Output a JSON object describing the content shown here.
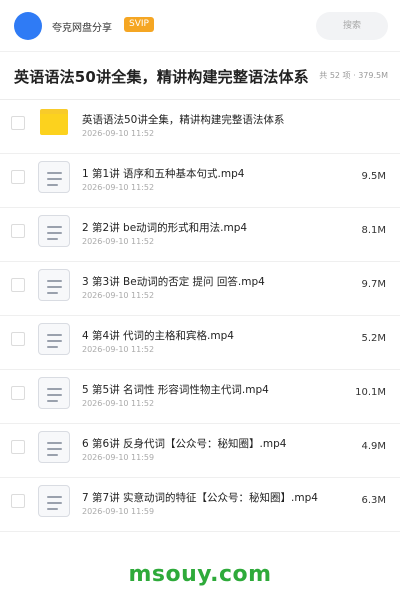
{
  "header": {
    "brand": "夸克网盘分享",
    "badge": "SVIP",
    "search_placeholder": "搜索"
  },
  "title_bar": {
    "title": "英语语法50讲全集，精讲构建完整语法体系",
    "meta": "共 52 项 · 379.5M"
  },
  "files": [
    {
      "type": "folder",
      "name": "英语语法50讲全集，精讲构建完整语法体系",
      "date": "2026-09-10 11:52",
      "size": ""
    },
    {
      "type": "file",
      "name": "1 第1讲 语序和五种基本句式.mp4",
      "date": "2026-09-10 11:52",
      "size": "9.5M"
    },
    {
      "type": "file",
      "name": "2 第2讲 be动词的形式和用法.mp4",
      "date": "2026-09-10 11:52",
      "size": "8.1M"
    },
    {
      "type": "file",
      "name": "3 第3讲 Be动词的否定 提问 回答.mp4",
      "date": "2026-09-10 11:52",
      "size": "9.7M"
    },
    {
      "type": "file",
      "name": "4 第4讲 代词的主格和宾格.mp4",
      "date": "2026-09-10 11:52",
      "size": "5.2M"
    },
    {
      "type": "file",
      "name": "5 第5讲 名词性 形容词性物主代词.mp4",
      "date": "2026-09-10 11:52",
      "size": "10.1M"
    },
    {
      "type": "file",
      "name": "6 第6讲 反身代词【公众号：秘知圈】.mp4",
      "date": "2026-09-10 11:59",
      "size": "4.9M"
    },
    {
      "type": "file",
      "name": "7 第7讲 实意动词的特征【公众号：秘知圈】.mp4",
      "date": "2026-09-10 11:59",
      "size": "6.3M"
    }
  ],
  "watermark": "msouy.com",
  "colors": {
    "accent": "#2f7bf5",
    "svip": "#f5a623",
    "folder": "#fcd21e",
    "watermark": "#2eaa3a"
  }
}
